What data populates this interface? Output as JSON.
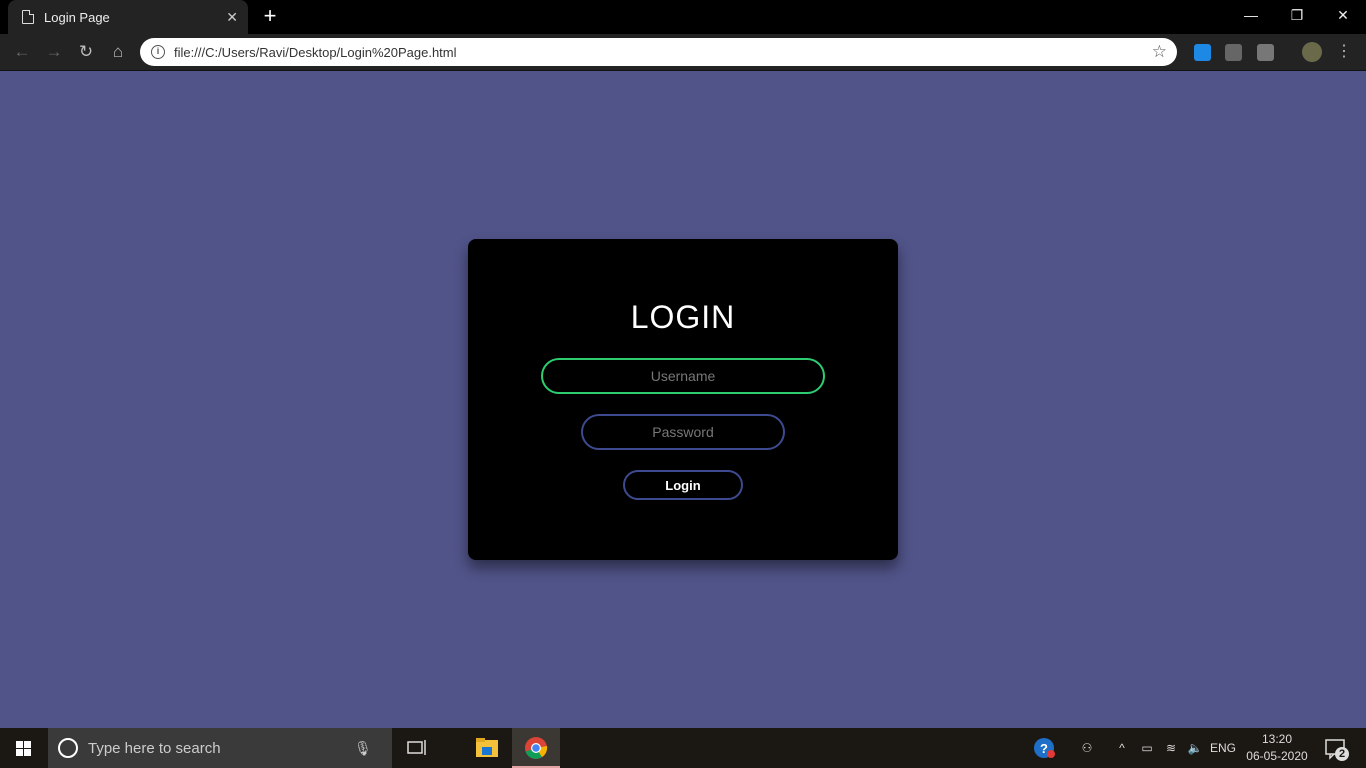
{
  "browser": {
    "tab_title": "Login Page",
    "tab_close": "✕",
    "new_tab": "+",
    "url": "file:///C:/Users/Ravi/Desktop/Login%20Page.html",
    "window_controls": {
      "minimize": "—",
      "restore": "❐",
      "close": "✕"
    }
  },
  "page": {
    "background": "#515489",
    "heading": "LOGIN",
    "username_placeholder": "Username",
    "password_placeholder": "Password",
    "login_button": "Login",
    "accent_focus": "#2ecc71",
    "accent_border": "#3d4a8f"
  },
  "taskbar": {
    "search_placeholder": "Type here to search",
    "language": "ENG",
    "time": "13:20",
    "date": "06-05-2020",
    "notification_count": "2"
  }
}
